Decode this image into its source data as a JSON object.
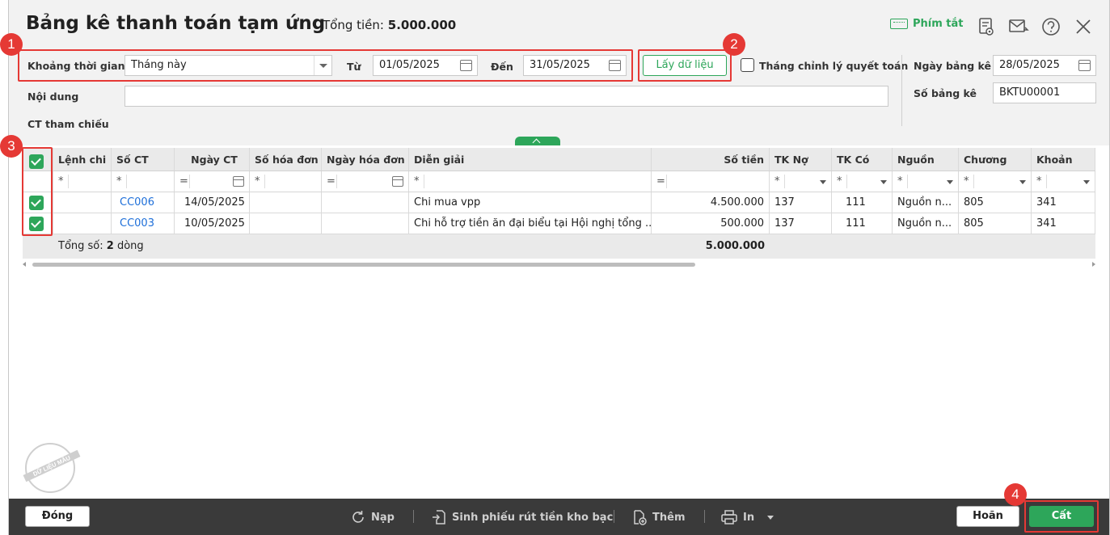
{
  "header": {
    "title": "Bảng kê thanh toán tạm ứng",
    "total_label": "Tổng tiền:",
    "total_value": "5.000.000",
    "shortcut_label": "Phím tắt"
  },
  "filters": {
    "period_label": "Khoảng thời gian",
    "period_value": "Tháng này",
    "from_label": "Từ",
    "from_value": "01/05/2025",
    "to_label": "Đến",
    "to_value": "31/05/2025",
    "get_data_label": "Lấy dữ liệu",
    "adjust_month_label": "Tháng chỉnh lý quyết toán",
    "content_label": "Nội dung",
    "content_value": "",
    "ref_label": "CT tham chiếu",
    "date_label": "Ngày bảng kê",
    "date_value": "28/05/2025",
    "number_label": "Số bảng kê",
    "number_value": "BKTU00001"
  },
  "badges": [
    "1",
    "2",
    "3",
    "4"
  ],
  "grid": {
    "columns": [
      "Lệnh chi",
      "Số CT",
      "Ngày CT",
      "Số hóa đơn",
      "Ngày hóa đơn",
      "Diễn giải",
      "Số tiền",
      "TK Nợ",
      "TK Có",
      "Nguồn",
      "Chương",
      "Khoản"
    ],
    "filter_ops": [
      "*",
      "*",
      "=",
      "*",
      "=",
      "*",
      "=",
      "*",
      "*",
      "*",
      "*",
      "*"
    ],
    "rows": [
      {
        "lenh_chi": "",
        "so_ct": "CC006",
        "ngay_ct": "14/05/2025",
        "so_hd": "",
        "ngay_hd": "",
        "dien_giai": "Chi mua vpp",
        "so_tien": "4.500.000",
        "tk_no": "137",
        "tk_co": "111",
        "nguon": "Nguồn n...",
        "chuong": "805",
        "khoan": "341"
      },
      {
        "lenh_chi": "",
        "so_ct": "CC003",
        "ngay_ct": "10/05/2025",
        "so_hd": "",
        "ngay_hd": "",
        "dien_giai": "Chi hỗ trợ tiền ăn đại biểu tại Hội nghị tổng ...",
        "so_tien": "500.000",
        "tk_no": "137",
        "tk_co": "111",
        "nguon": "Nguồn n...",
        "chuong": "805",
        "khoan": "341"
      }
    ],
    "total_prefix": "Tổng số:",
    "total_count": "2",
    "total_suffix": "dòng",
    "total_amount": "5.000.000"
  },
  "stamp_text": "DỮ LIỆU MẪU",
  "footer": {
    "close_label": "Đóng",
    "reload_label": "Nạp",
    "generate_label": "Sinh phiếu rút tiền kho bạc",
    "add_label": "Thêm",
    "print_label": "In",
    "cancel_label": "Hoãn",
    "save_label": "Cất"
  },
  "colors": {
    "accent": "#2da65a",
    "highlight": "#e53935",
    "link": "#1e6fd9"
  }
}
